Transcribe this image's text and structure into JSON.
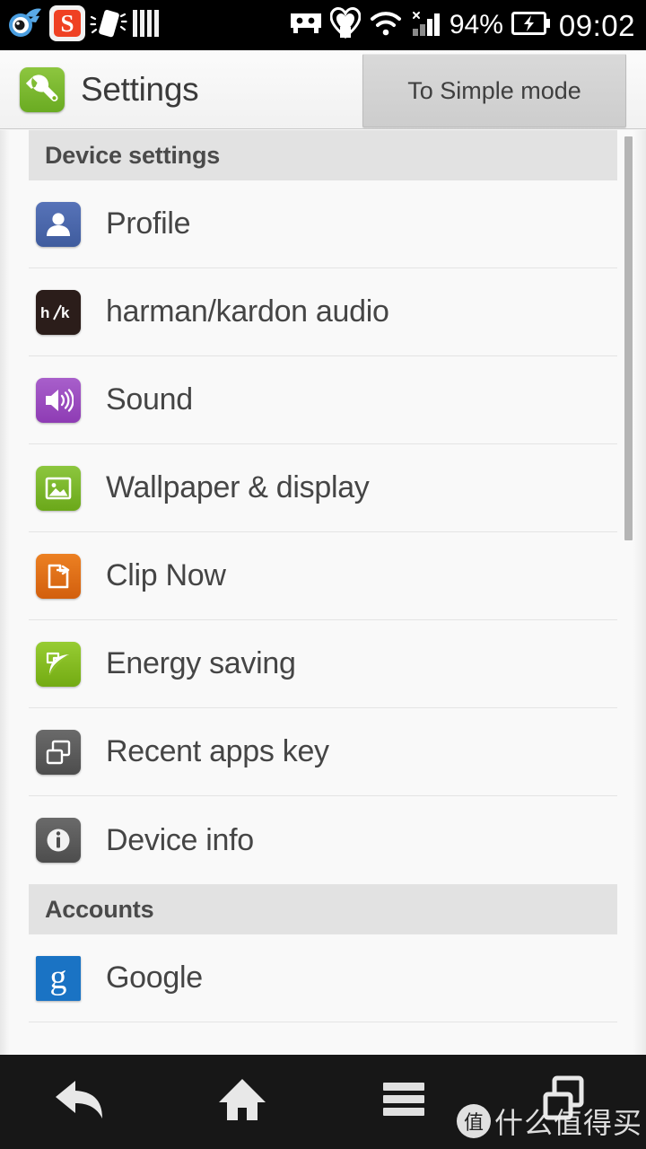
{
  "statusbar": {
    "left_icons": [
      {
        "name": "comet-notification-icon",
        "glyph": "comet"
      },
      {
        "name": "sogou-input-icon",
        "glyph": "S"
      },
      {
        "name": "shake-phone-icon",
        "glyph": "shake"
      },
      {
        "name": "bars-notification-icon",
        "glyph": "bars"
      }
    ],
    "right_icons": [
      {
        "name": "usb-debugging-icon",
        "glyph": "usb"
      },
      {
        "name": "heart-notification-icon",
        "glyph": "heart"
      },
      {
        "name": "wifi-icon",
        "glyph": "wifi"
      },
      {
        "name": "cellular-signal-icon",
        "glyph": "signal"
      }
    ],
    "battery_percent": "94%",
    "battery_state": "charging",
    "clock": "09:02"
  },
  "header": {
    "app_icon": "wrench-icon",
    "title": "Settings",
    "simple_mode_button": "To Simple mode"
  },
  "list": [
    {
      "type": "section",
      "name": "device-settings",
      "label": "Device settings",
      "items": [
        {
          "label": "Profile",
          "icon": "person-icon",
          "color": "#4a69ad"
        },
        {
          "label": "harman/kardon audio",
          "icon": "hk-logo-icon",
          "color": "#2b1d1a"
        },
        {
          "label": "Sound",
          "icon": "speaker-icon",
          "color": "#9b4fc0"
        },
        {
          "label": "Wallpaper & display",
          "icon": "picture-icon",
          "color": "#7ab51d"
        },
        {
          "label": "Clip Now",
          "icon": "clip-icon",
          "color": "#e2721a"
        },
        {
          "label": "Energy saving",
          "icon": "leaf-icon",
          "color": "#86bf23"
        },
        {
          "label": "Recent apps key",
          "icon": "windows-stack-icon",
          "color": "#575757"
        },
        {
          "label": "Device info",
          "icon": "info-icon",
          "color": "#575757"
        }
      ]
    },
    {
      "type": "section",
      "name": "accounts",
      "label": "Accounts",
      "items": [
        {
          "label": "Google",
          "icon": "google-g-icon",
          "color": "#1a73c4"
        }
      ]
    }
  ],
  "navbar": {
    "buttons": [
      {
        "name": "back-button",
        "icon": "back-arrow-icon"
      },
      {
        "name": "home-button",
        "icon": "home-icon"
      },
      {
        "name": "menu-button",
        "icon": "hamburger-menu-icon"
      },
      {
        "name": "recent-apps-button",
        "icon": "recent-apps-icon"
      }
    ]
  },
  "watermark": {
    "badge": "值",
    "text": "什么值得买"
  },
  "scrollbar": {
    "name": "vertical-scrollbar"
  }
}
